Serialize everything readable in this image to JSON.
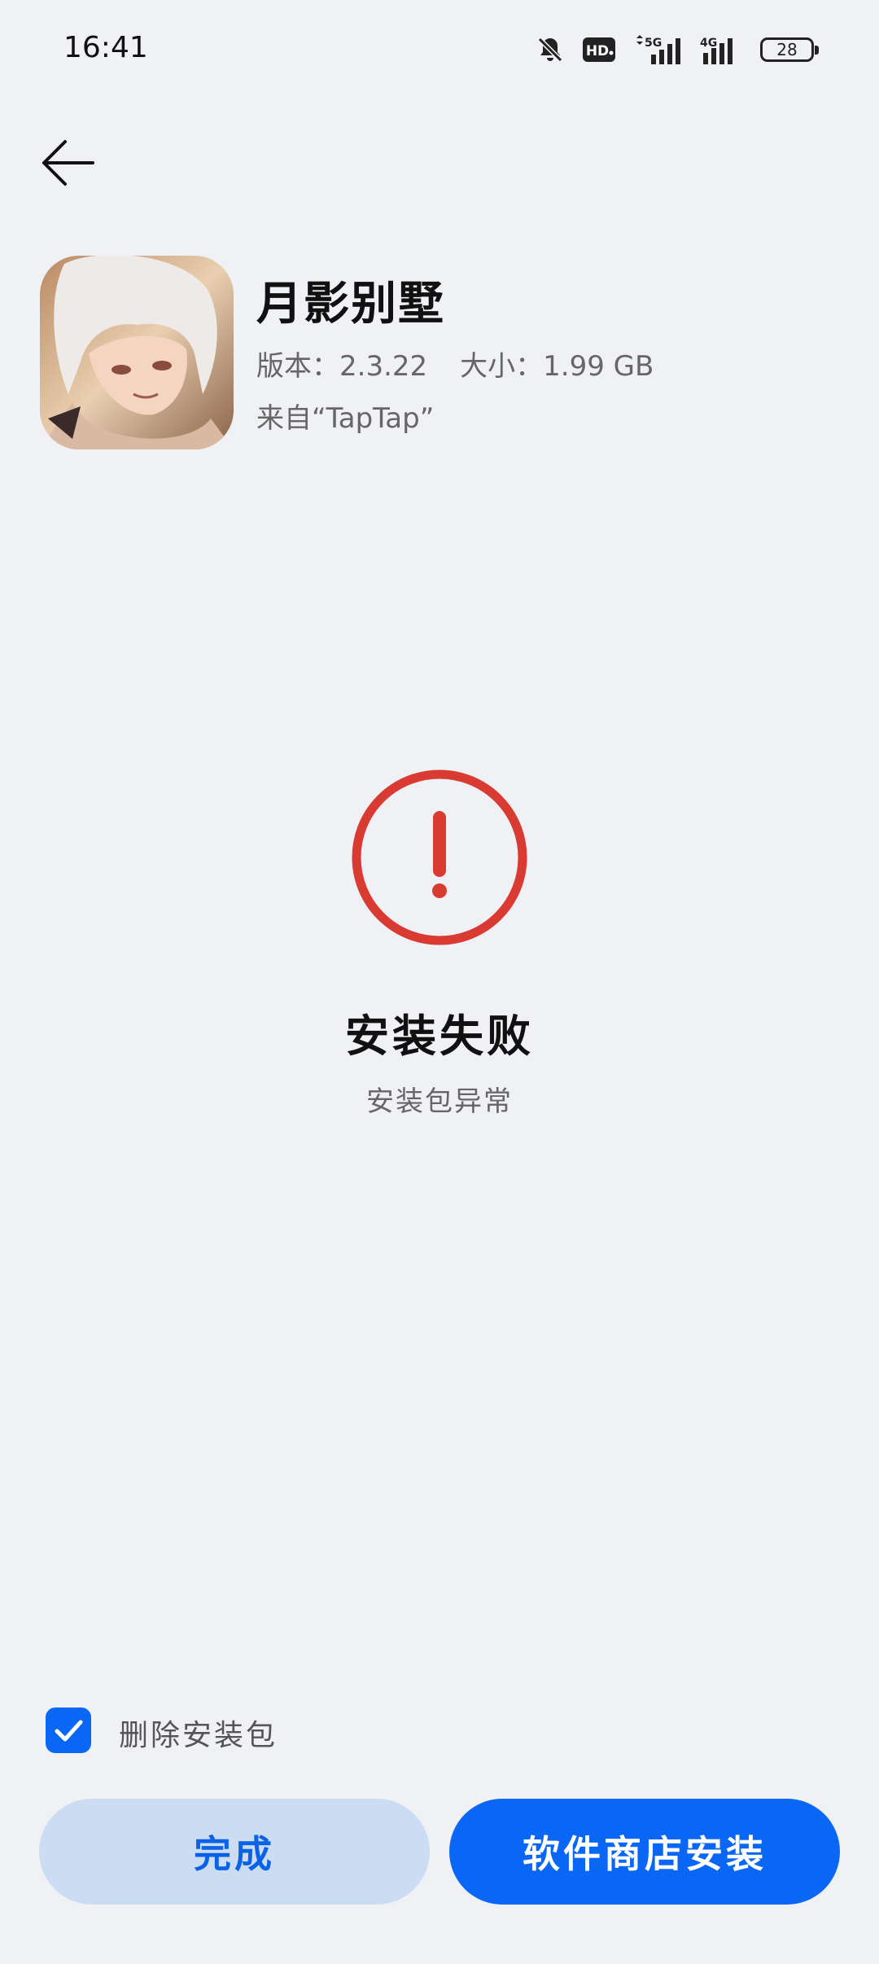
{
  "status_bar": {
    "time": "16:41",
    "network_5g": "5G",
    "network_4g": "4G",
    "hd_badge": "HD",
    "battery": "28"
  },
  "app": {
    "name": "月影别墅",
    "version": "版本：2.3.22",
    "size": "大小：1.99 GB",
    "source": "来自“TapTap”"
  },
  "result": {
    "title": "安装失败",
    "subtitle": "安装包异常",
    "accent_color": "#d93a32"
  },
  "options": {
    "delete_package_label": "删除安装包",
    "delete_package_checked": true
  },
  "buttons": {
    "done_label": "完成",
    "store_install_label": "软件商店安装"
  },
  "colors": {
    "primary": "#0a66f5",
    "secondary_button_bg": "#ccdcf3",
    "background": "#f0f1f4"
  }
}
